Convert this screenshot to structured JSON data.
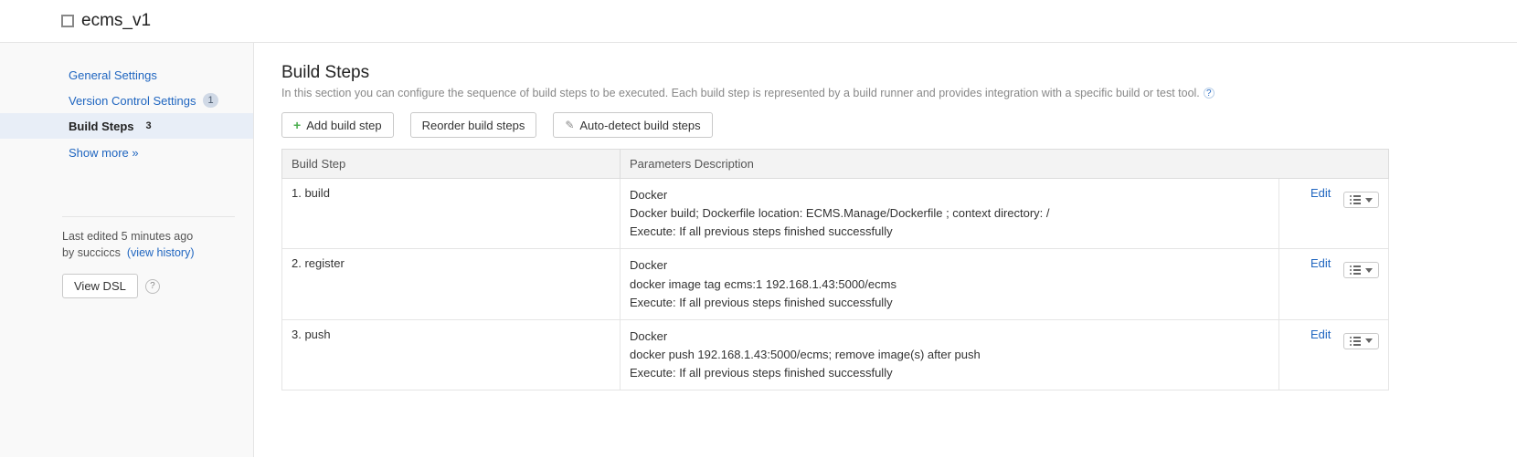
{
  "header": {
    "title": "ecms_v1"
  },
  "sidebar": {
    "items": [
      {
        "label": "General Settings",
        "badge": null,
        "active": false
      },
      {
        "label": "Version Control Settings",
        "badge": "1",
        "active": false
      },
      {
        "label": "Build Steps",
        "badge": "3",
        "active": true
      }
    ],
    "show_more": "Show more »",
    "last_edited_prefix": "Last edited ",
    "last_edited_time": "5 minutes ago",
    "by_prefix": "by ",
    "by_user": "succiccs",
    "view_history": "(view history)",
    "view_dsl": "View DSL"
  },
  "main": {
    "title": "Build Steps",
    "description": "In this section you can configure the sequence of build steps to be executed. Each build step is represented by a build runner and provides integration with a specific build or test tool.",
    "buttons": {
      "add": "Add build step",
      "reorder": "Reorder build steps",
      "autodetect": "Auto-detect build steps"
    },
    "table": {
      "headers": {
        "step": "Build Step",
        "params": "Parameters Description"
      },
      "rows": [
        {
          "name": "1. build",
          "runner": "Docker",
          "detail": "Docker build; Dockerfile location: ECMS.Manage/Dockerfile ; context directory: /",
          "execute": "Execute: If all previous steps finished successfully",
          "edit": "Edit"
        },
        {
          "name": "2. register",
          "runner": "Docker",
          "detail": "docker image tag ecms:1 192.168.1.43:5000/ecms",
          "execute": "Execute: If all previous steps finished successfully",
          "edit": "Edit"
        },
        {
          "name": "3. push",
          "runner": "Docker",
          "detail": "docker push 192.168.1.43:5000/ecms; remove image(s) after push",
          "execute": "Execute: If all previous steps finished successfully",
          "edit": "Edit"
        }
      ]
    }
  }
}
